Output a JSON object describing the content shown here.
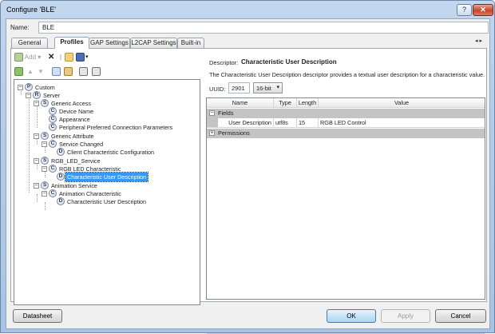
{
  "window": {
    "title": "Configure 'BLE'",
    "help_glyph": "?",
    "close_glyph": "✕"
  },
  "name_row": {
    "label": "Name:",
    "value": "BLE"
  },
  "tabs": [
    {
      "label": "General"
    },
    {
      "label": "Profiles",
      "active": true
    },
    {
      "label": "GAP Settings"
    },
    {
      "label": "L2CAP Settings"
    },
    {
      "label": "Built-in"
    }
  ],
  "tab_scroll": {
    "left": "◂",
    "right": "▸"
  },
  "toolbar": {
    "add_label": "Add",
    "add_dropdown": "▾",
    "delete_glyph": "✕"
  },
  "tree": {
    "nodes": [
      {
        "label": "Custom",
        "icon": "P"
      },
      {
        "label": "Server",
        "icon": "R"
      },
      {
        "label": "Generic Access",
        "icon": "S"
      },
      {
        "label": "Device Name",
        "icon": "C"
      },
      {
        "label": "Appearance",
        "icon": "C"
      },
      {
        "label": "Peripheral Preferred Connection Parameters",
        "icon": "C"
      },
      {
        "label": "Generic Attribute",
        "icon": "S"
      },
      {
        "label": "Service Changed",
        "icon": "C"
      },
      {
        "label": "Client Characteristic Configuration",
        "icon": "D"
      },
      {
        "label": "RGB_LED_Service",
        "icon": "S"
      },
      {
        "label": "RGB LED Characteristic",
        "icon": "C"
      },
      {
        "label": "Characteristic User Description",
        "icon": "D",
        "selected": true
      },
      {
        "label": "Animation Service",
        "icon": "S"
      },
      {
        "label": "Animation Characteristic",
        "icon": "C"
      },
      {
        "label": "Characteristic User Description",
        "icon": "D"
      }
    ]
  },
  "descriptor": {
    "label": "Descriptor:",
    "name": "Characteristic User Description",
    "text": "The Characteristic User Description descriptor provides a textual user description for a characteristic value.",
    "uuid_label": "UUID:",
    "uuid_value": "2901",
    "bit_select": "16-bit"
  },
  "grid": {
    "headers": [
      "Name",
      "Type",
      "Length",
      "Value"
    ],
    "categories": [
      {
        "label": "Fields",
        "expander": "−"
      },
      {
        "label": "Permissions",
        "expander": "+"
      }
    ],
    "rows": [
      {
        "name": "User Description",
        "type": "utf8s",
        "length": "15",
        "value": "RGB LED Control"
      }
    ]
  },
  "buttons": {
    "datasheet": "Datasheet",
    "ok": "OK",
    "apply": "Apply",
    "cancel": "Cancel"
  },
  "colors": {
    "selection": "#3399ff",
    "category_band": "#c4c4c4",
    "title_gradient": "#b7cde8"
  }
}
